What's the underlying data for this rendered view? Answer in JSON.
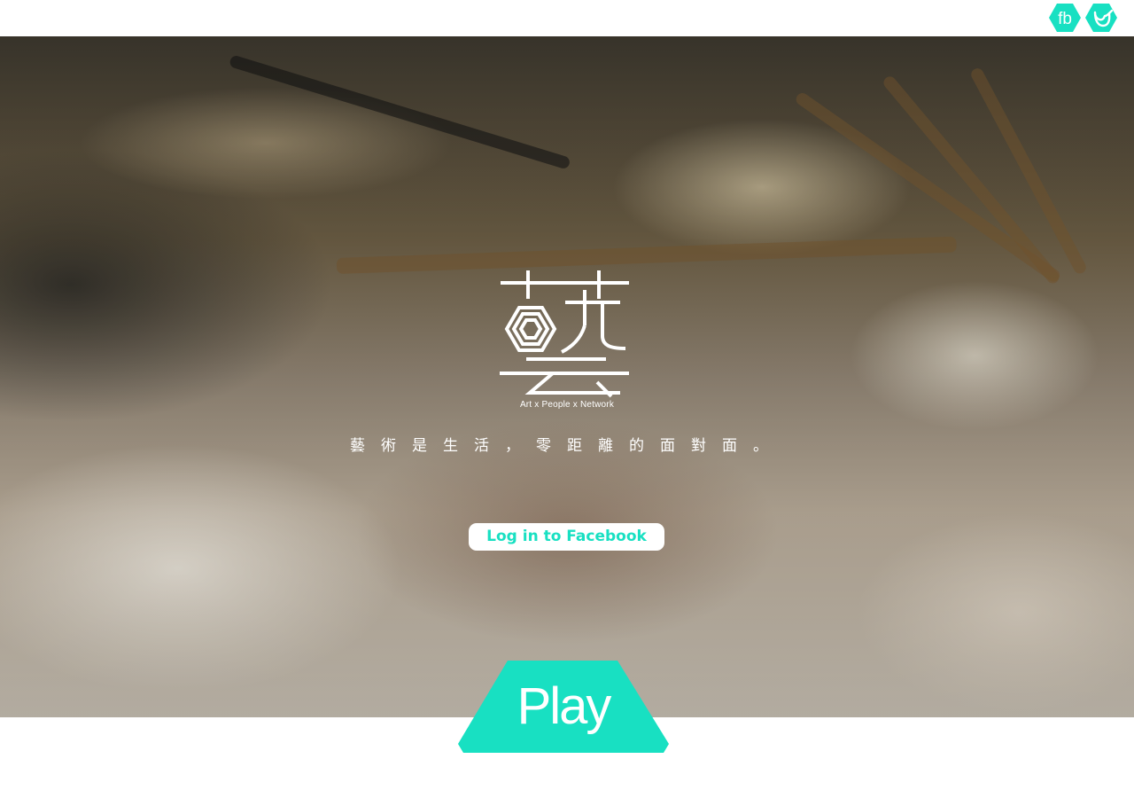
{
  "header": {
    "social": [
      {
        "name": "facebook",
        "label": "fb",
        "icon": "facebook-hexagon-icon"
      },
      {
        "name": "twitter",
        "icon": "bird-hexagon-icon"
      }
    ]
  },
  "hero": {
    "background": "blurred-bookstore-photo",
    "logo_icon": "art-character-logo-icon",
    "logo_caption": "Art x People x Network",
    "tagline": "藝術是生活，零距離的面對面。",
    "login_button": "Log in to Facebook",
    "play_button": "Play"
  },
  "colors": {
    "accent": "#18e0c2",
    "white": "#ffffff"
  }
}
